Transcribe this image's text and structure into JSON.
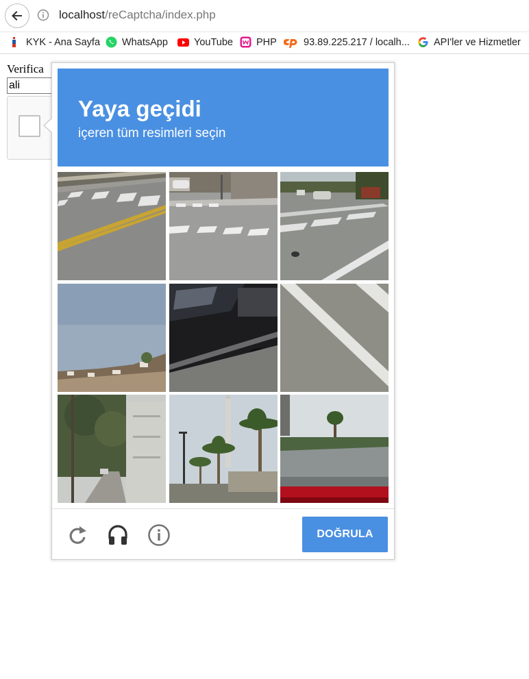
{
  "browser": {
    "url_host": "localhost",
    "url_path": "/reCaptcha/index.php",
    "bookmarks": [
      {
        "label": "KYK - Ana Sayfa",
        "icon": "kyk-icon"
      },
      {
        "label": "WhatsApp",
        "icon": "whatsapp-icon"
      },
      {
        "label": "YouTube",
        "icon": "youtube-icon"
      },
      {
        "label": "PHP",
        "icon": "wamp-icon"
      },
      {
        "label": "93.89.225.217 / localh...",
        "icon": "cpanel-icon"
      },
      {
        "label": "API'ler ve Hizmetler",
        "icon": "google-icon"
      }
    ]
  },
  "page": {
    "label": "Verifica",
    "input_value": "ali"
  },
  "challenge": {
    "title": "Yaya geçidi",
    "subtitle": "içeren tüm resimleri seçin",
    "verify_label": "DOĞRULA",
    "tiles": [
      "road-crosswalk",
      "street-crosswalk-corner",
      "intersection",
      "hillside-sky",
      "black-car",
      "crosswalk-stripe",
      "sidewalk-trees-house",
      "palm-trees-street",
      "palm-tree-car"
    ],
    "footer_icons": [
      "reload-icon",
      "audio-icon",
      "info-icon"
    ],
    "colors": {
      "accent": "#4a90e2"
    }
  }
}
